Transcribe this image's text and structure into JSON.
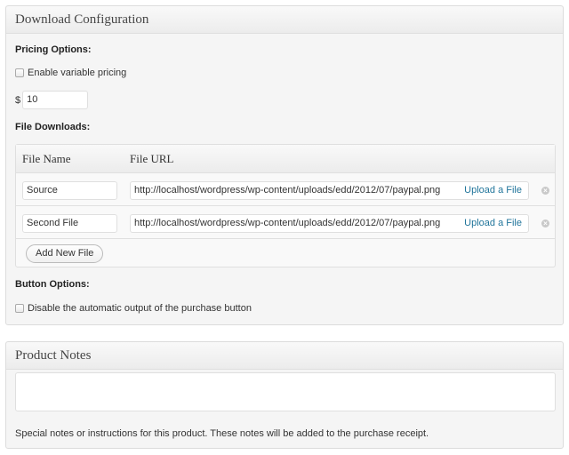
{
  "download_config": {
    "title": "Download Configuration",
    "pricing_options_label": "Pricing Options:",
    "variable_pricing_label": "Enable variable pricing",
    "currency_symbol": "$",
    "price_value": "10",
    "file_downloads_label": "File Downloads:",
    "columns": {
      "file_name": "File Name",
      "file_url": "File URL"
    },
    "files": [
      {
        "name": "Source",
        "url": "http://localhost/wordpress/wp-content/uploads/edd/2012/07/paypal.png",
        "upload_label": "Upload a File"
      },
      {
        "name": "Second File",
        "url": "http://localhost/wordpress/wp-content/uploads/edd/2012/07/paypal.png",
        "upload_label": "Upload a File"
      }
    ],
    "add_file_label": "Add New File",
    "button_options_label": "Button Options:",
    "disable_output_label": "Disable the automatic output of the purchase button"
  },
  "product_notes": {
    "title": "Product Notes",
    "textarea_value": "",
    "description": "Special notes or instructions for this product. These notes will be added to the purchase receipt."
  },
  "icons": {
    "remove": "remove-circle-icon",
    "checkbox": "checkbox-icon"
  },
  "colors": {
    "link": "#21759b",
    "panel_background": "#f5f5f5",
    "border": "#dfdfdf"
  }
}
